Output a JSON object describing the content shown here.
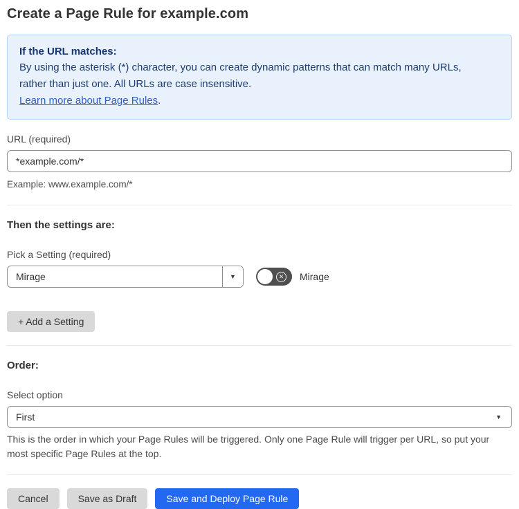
{
  "page": {
    "title": "Create a Page Rule for example.com"
  },
  "info_box": {
    "heading": "If the URL matches:",
    "body": "By using the asterisk (*) character, you can create dynamic patterns that can match many URLs, rather than just one. All URLs are case insensitive.",
    "link_label": "Learn more about Page Rules",
    "link_suffix": "."
  },
  "url_field": {
    "label": "URL (required)",
    "value": "*example.com/*",
    "example": "Example: www.example.com/*"
  },
  "settings_section": {
    "heading": "Then the settings are:",
    "picker_label": "Pick a Setting (required)",
    "picker_value": "Mirage",
    "toggle_label": "Mirage",
    "toggle_state": "off",
    "toggle_icon": "✕",
    "dropdown_arrow": "▼",
    "add_setting_label": "+ Add a Setting"
  },
  "order_section": {
    "heading": "Order:",
    "select_label": "Select option",
    "select_value": "First",
    "dropdown_arrow": "▼",
    "help_text": "This is the order in which your Page Rules will be triggered. Only one Page Rule will trigger per URL, so put your most specific Page Rules at the top."
  },
  "footer": {
    "cancel_label": "Cancel",
    "save_draft_label": "Save as Draft",
    "save_deploy_label": "Save and Deploy Page Rule"
  },
  "colors": {
    "accent_blue": "#2268f0",
    "info_bg": "#e9f2fc",
    "info_border": "#b7d4f1",
    "info_text": "#1e3c72",
    "link_blue": "#2c5fc7",
    "button_gray": "#d9d9d9",
    "toggle_off_bg": "#4f4f4f",
    "input_border": "#8e8e8e"
  }
}
